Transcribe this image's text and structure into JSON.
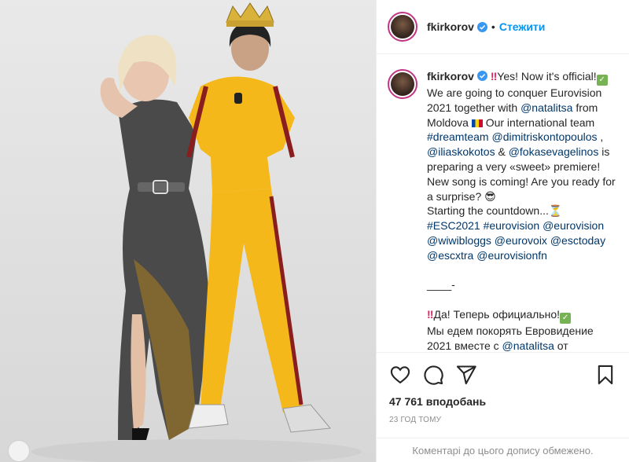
{
  "post": {
    "username": "fkirkorov",
    "follow_label": "Стежити",
    "separator": "•",
    "caption": {
      "line1_text": "Yes! Now it's official!",
      "line2": "We are going to conquer Eurovision 2021 together with ",
      "mention_natalitsa": "@natalitsa",
      "line2b": " from Moldova ",
      "line3": " Our international team ",
      "tag_dreamteam": "#dreamteam",
      "mention_dimitris": "@dimitriskontopoulos",
      "comma": " , ",
      "mention_ilias": "@iliaskokotos",
      "amp": " & ",
      "mention_fokas": "@fokasevagelinos",
      "line4": " is preparing a very «sweet» premiere! New song is coming! Are you ready for a surprise? ",
      "line5": "Starting the countdown...",
      "tags": "#ESC2021 #eurovision @eurovision @wiwibloggs @eurovoix @esctoday @escxtra @eurovisionfn",
      "divider": "____-",
      "ru_line1": "Да! Теперь официально!",
      "ru_line2": "Мы едем покорять Евровидение 2021 вместе с ",
      "ru_mention": "@natalitsa",
      "ru_line2b": " от"
    },
    "likes": "47 761 вподобань",
    "time": "23 год тому",
    "comments_limited": "Коментарі до цього допису обмежено.",
    "colors": {
      "accent": "#0095f6",
      "link": "#00376b",
      "muted": "#8e8e8e"
    }
  }
}
